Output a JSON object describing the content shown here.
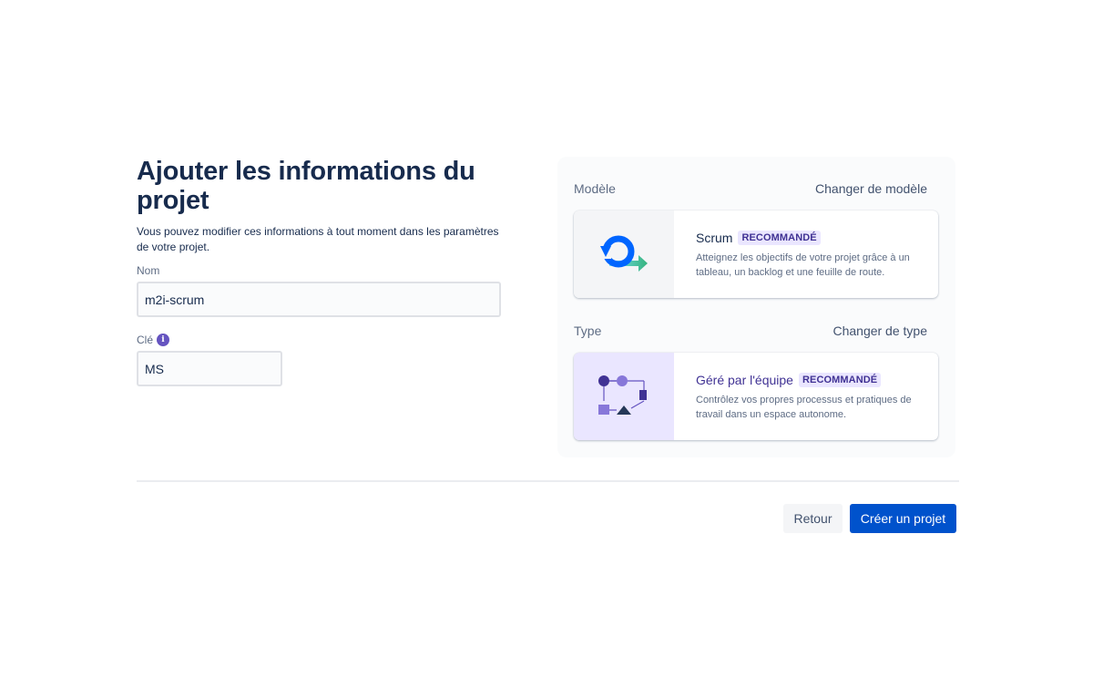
{
  "form": {
    "title": "Ajouter les informations du projet",
    "subtitle": "Vous pouvez modifier ces informations à tout moment dans les paramètres de votre projet.",
    "name_label": "Nom",
    "name_value": "m2i-scrum",
    "key_label": "Clé",
    "key_value": "MS",
    "info_glyph": "i"
  },
  "template": {
    "section_label": "Modèle",
    "change_label": "Changer de modèle",
    "title": "Scrum",
    "badge": "RECOMMANDÉ",
    "description": "Atteignez les objectifs de votre projet grâce à un tableau, un backlog et une feuille de route."
  },
  "type": {
    "section_label": "Type",
    "change_label": "Changer de type",
    "title": "Géré par l'équipe",
    "badge": "RECOMMANDÉ",
    "description": "Contrôlez vos propres processus et pratiques de travail dans un espace autonome."
  },
  "footer": {
    "back_label": "Retour",
    "create_label": "Créer un projet"
  },
  "colors": {
    "primary": "#0052cc",
    "badge_bg": "#eae6ff",
    "badge_text": "#403294",
    "info_icon": "#6554c0"
  }
}
